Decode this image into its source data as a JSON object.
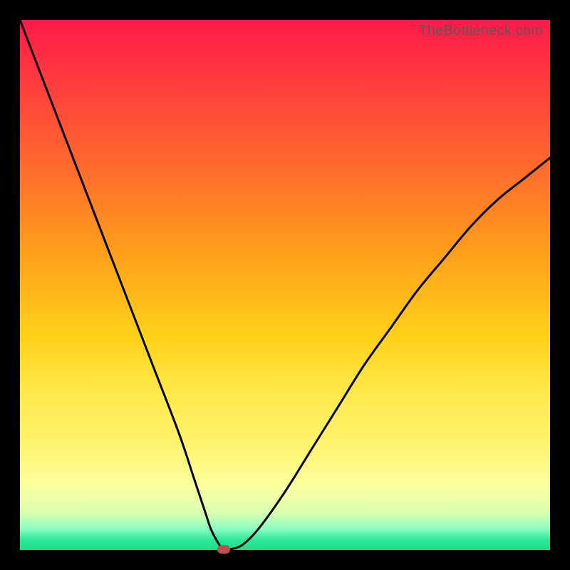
{
  "watermark": "TheBottleneck.com",
  "chart_data": {
    "type": "line",
    "title": "",
    "xlabel": "",
    "ylabel": "",
    "xlim": [
      0,
      100
    ],
    "ylim": [
      0,
      100
    ],
    "grid": false,
    "legend": false,
    "x": [
      0,
      5,
      10,
      15,
      20,
      25,
      30,
      33,
      35,
      36,
      37,
      38,
      39,
      40,
      42,
      45,
      50,
      55,
      60,
      65,
      70,
      75,
      80,
      85,
      90,
      95,
      100
    ],
    "y": [
      100,
      87,
      74,
      61,
      48,
      35,
      22,
      13,
      7,
      4,
      2,
      0.5,
      0.2,
      0.2,
      1,
      4,
      11,
      19,
      27,
      35,
      42,
      49,
      55,
      61,
      66,
      70,
      74
    ],
    "marker": {
      "x": 38.5,
      "y": 0.2
    },
    "gradient_stops": [
      {
        "pos": 0.0,
        "color": "#ff1a4a"
      },
      {
        "pos": 0.28,
        "color": "#ff6b2d"
      },
      {
        "pos": 0.6,
        "color": "#ffd21a"
      },
      {
        "pos": 0.88,
        "color": "#fcffa0"
      },
      {
        "pos": 0.98,
        "color": "#2fe89a"
      },
      {
        "pos": 1.0,
        "color": "#1fdc88"
      }
    ]
  }
}
